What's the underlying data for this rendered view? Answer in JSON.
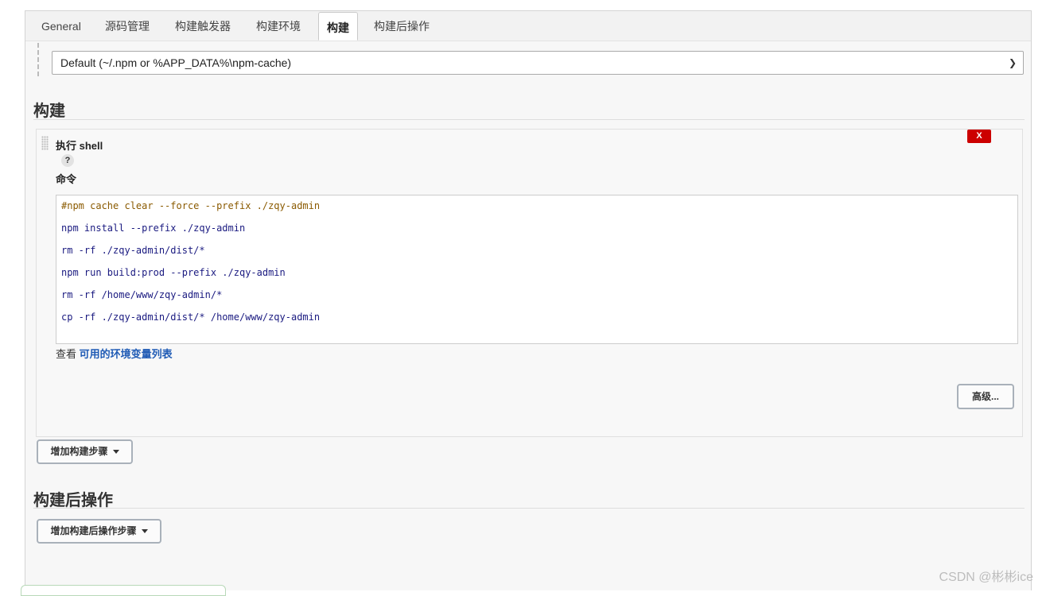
{
  "tabs": [
    "General",
    "源码管理",
    "构建触发器",
    "构建环境",
    "构建",
    "构建后操作"
  ],
  "active_tab": "构建",
  "npm_cache": {
    "selected": "Default (~/.npm or %APP_DATA%\\npm-cache)"
  },
  "build": {
    "heading": "构建",
    "step": {
      "title": "执行 shell",
      "delete_label": "X",
      "help_label": "?",
      "command_label": "命令",
      "lines": [
        "#npm cache clear --force --prefix ./zqy-admin",
        "npm install --prefix ./zqy-admin",
        "rm -rf ./zqy-admin/dist/*",
        "npm run build:prod --prefix ./zqy-admin",
        "rm -rf /home/www/zqy-admin/*",
        "cp -rf ./zqy-admin/dist/* /home/www/zqy-admin"
      ],
      "env_prefix": "查看",
      "env_link": "可用的环境变量列表",
      "advanced_label": "高级..."
    },
    "add_step_label": "增加构建步骤"
  },
  "post_build": {
    "heading": "构建后操作",
    "add_step_label": "增加构建后操作步骤"
  },
  "watermark": "CSDN @彬彬ice"
}
